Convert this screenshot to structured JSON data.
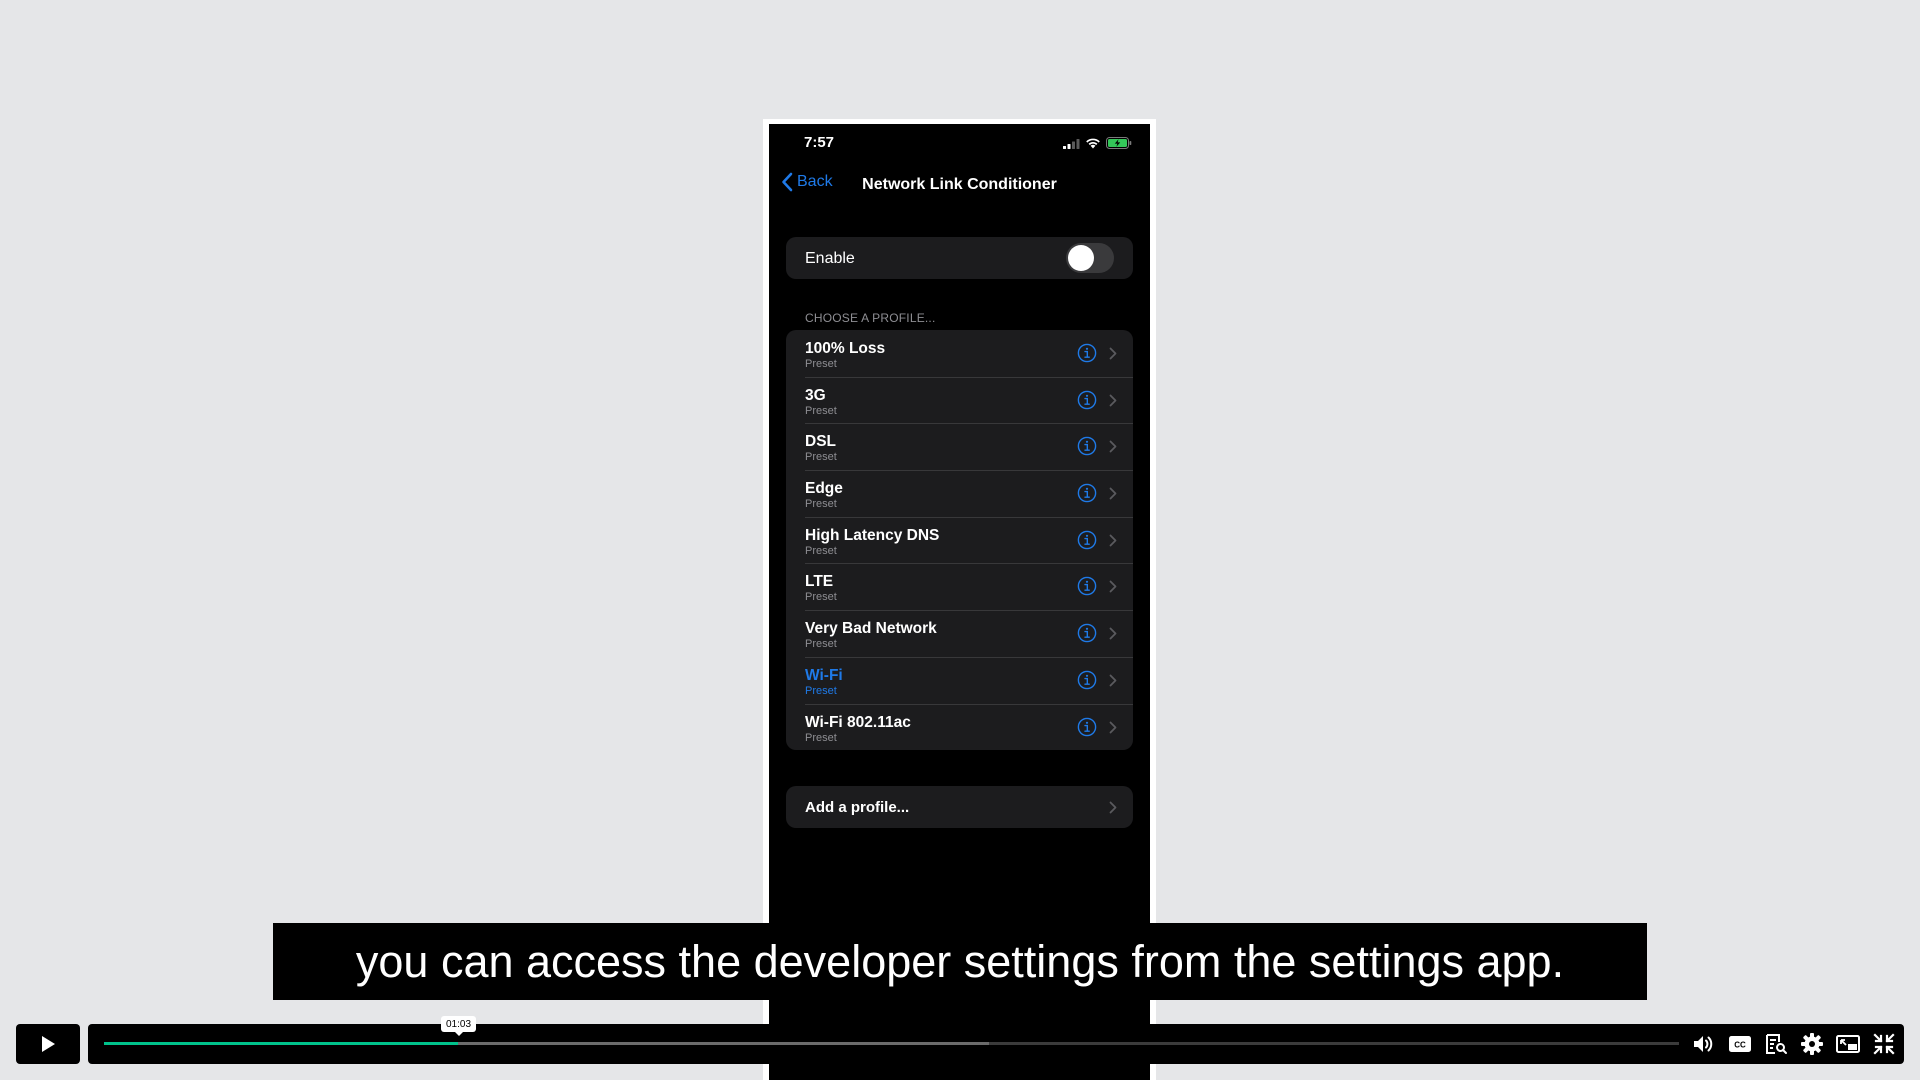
{
  "status": {
    "time": "7:57"
  },
  "nav": {
    "back_label": "Back",
    "title": "Network Link Conditioner"
  },
  "enable": {
    "label": "Enable",
    "on": false
  },
  "profiles": {
    "header": "CHOOSE A PROFILE...",
    "items": [
      {
        "name": "100% Loss",
        "sub": "Preset",
        "selected": false
      },
      {
        "name": "3G",
        "sub": "Preset",
        "selected": false
      },
      {
        "name": "DSL",
        "sub": "Preset",
        "selected": false
      },
      {
        "name": "Edge",
        "sub": "Preset",
        "selected": false
      },
      {
        "name": "High Latency DNS",
        "sub": "Preset",
        "selected": false
      },
      {
        "name": "LTE",
        "sub": "Preset",
        "selected": false
      },
      {
        "name": "Very Bad Network",
        "sub": "Preset",
        "selected": false
      },
      {
        "name": "Wi-Fi",
        "sub": "Preset",
        "selected": true
      },
      {
        "name": "Wi-Fi 802.11ac",
        "sub": "Preset",
        "selected": false
      }
    ]
  },
  "add_profile": {
    "label": "Add a profile..."
  },
  "caption": {
    "text": "you can access the developer settings from the settings app."
  },
  "player": {
    "hover_time": "01:03",
    "played_fraction": 0.225,
    "loaded_fraction": 0.562,
    "icons": [
      "volume-icon",
      "closed-captions-icon",
      "transcript-icon",
      "settings-icon",
      "picture-in-picture-icon",
      "exit-fullscreen-icon"
    ]
  },
  "colors": {
    "ios_blue": "#1f7ae8",
    "progress_green": "#00c28b"
  }
}
